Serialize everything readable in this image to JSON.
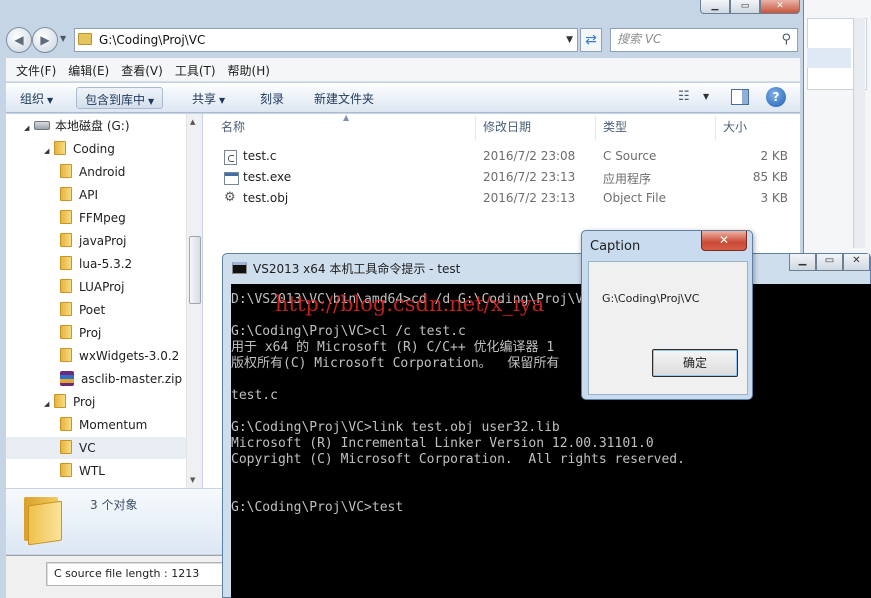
{
  "address": {
    "path": "G:\\Coding\\Proj\\VC"
  },
  "search": {
    "placeholder": "搜索 VC"
  },
  "menu": [
    "文件(F)",
    "编辑(E)",
    "查看(V)",
    "工具(T)",
    "帮助(H)"
  ],
  "toolbar": {
    "organize": "组织",
    "include_library": "包含到库中",
    "share": "共享",
    "burn": "刻录",
    "new_folder": "新建文件夹"
  },
  "nav_tree": [
    {
      "label": "本地磁盘 (G:)",
      "kind": "drive",
      "depth": 0,
      "expanded": true
    },
    {
      "label": "Coding",
      "kind": "folder",
      "depth": 1,
      "expanded": true
    },
    {
      "label": "Android",
      "kind": "folder",
      "depth": 2
    },
    {
      "label": "API",
      "kind": "folder",
      "depth": 2
    },
    {
      "label": "FFMpeg",
      "kind": "folder",
      "depth": 2
    },
    {
      "label": "javaProj",
      "kind": "folder",
      "depth": 2
    },
    {
      "label": "lua-5.3.2",
      "kind": "folder",
      "depth": 2
    },
    {
      "label": "LUAProj",
      "kind": "folder",
      "depth": 2
    },
    {
      "label": "Poet",
      "kind": "folder",
      "depth": 2
    },
    {
      "label": "Proj",
      "kind": "folder",
      "depth": 2
    },
    {
      "label": "wxWidgets-3.0.2",
      "kind": "folder",
      "depth": 2
    },
    {
      "label": "asclib-master.zip",
      "kind": "zip",
      "depth": 2
    },
    {
      "label": "Proj",
      "kind": "folder",
      "depth": 1,
      "expanded": true
    },
    {
      "label": "Momentum",
      "kind": "folder",
      "depth": 2
    },
    {
      "label": "VC",
      "kind": "folder",
      "depth": 2,
      "selected": true
    },
    {
      "label": "WTL",
      "kind": "folder",
      "depth": 2
    }
  ],
  "columns": {
    "name": "名称",
    "date": "修改日期",
    "type": "类型",
    "size": "大小"
  },
  "files": [
    {
      "name": "test.c",
      "date": "2016/7/2 23:08",
      "type": "C Source",
      "size": "2 KB",
      "icon": "c-source-icon"
    },
    {
      "name": "test.exe",
      "date": "2016/7/2 23:13",
      "type": "应用程序",
      "size": "85 KB",
      "icon": "exe-icon"
    },
    {
      "name": "test.obj",
      "date": "2016/7/2 23:13",
      "type": "Object File",
      "size": "3 KB",
      "icon": "obj-icon"
    }
  ],
  "details": {
    "count": "3 个对象"
  },
  "status": {
    "text": "C source file length : 1213"
  },
  "console": {
    "title": "VS2013 x64 本机工具命令提示 - test",
    "watermark": "http://blog.csdn.net/x_iya",
    "lines": [
      "D:\\VS2013\\VC\\bin\\amd64>cd /d G:\\Coding\\Proj\\VC",
      "",
      "G:\\Coding\\Proj\\VC>cl /c test.c",
      "用于 x64 的 Microsoft (R) C/C++ 优化编译器 1",
      "版权所有(C) Microsoft Corporation。  保留所有",
      "",
      "test.c",
      "",
      "G:\\Coding\\Proj\\VC>link test.obj user32.lib",
      "Microsoft (R) Incremental Linker Version 12.00.31101.0",
      "Copyright (C) Microsoft Corporation.  All rights reserved.",
      "",
      "",
      "G:\\Coding\\Proj\\VC>test"
    ]
  },
  "msgbox": {
    "caption": "Caption",
    "text": "G:\\Coding\\Proj\\VC",
    "ok": "确定"
  }
}
